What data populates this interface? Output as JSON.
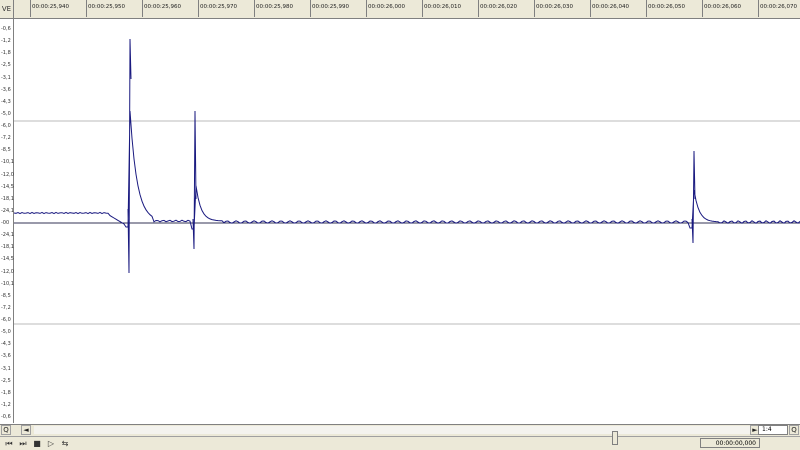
{
  "ruler": {
    "corner_icon": "VE",
    "ticks": [
      "00:00:25,940",
      "00:00:25,950",
      "00:00:25,960",
      "00:00:25,970",
      "00:00:25,980",
      "00:00:25,990",
      "00:00:26,000",
      "00:00:26,010",
      "00:00:26,020",
      "00:00:26,030",
      "00:00:26,040",
      "00:00:26,050",
      "00:00:26,060",
      "00:00:26,070"
    ]
  },
  "yaxis": {
    "labels": [
      "-0,6",
      "-1,2",
      "-1,8",
      "-2,5",
      "-3,1",
      "-3,6",
      "-4,3",
      "-5,0",
      "-6,0",
      "-7,2",
      "-8,5",
      "-10,1",
      "-12,0",
      "-14,5",
      "-18,1",
      "-24,1",
      "-00",
      "-24,1",
      "-18,1",
      "-14,5",
      "-12,0",
      "-10,1",
      "-8,5",
      "-7,2",
      "-6,0",
      "-5,0",
      "-4,3",
      "-3,6",
      "-3,1",
      "-2,5",
      "-1,8",
      "-1,2",
      "-0,6"
    ]
  },
  "waveform": {
    "color": "#1a1a80",
    "center_line_color": "#333355",
    "grid_color": "#bbbbbb"
  },
  "hscroll": {
    "left_button": "Q",
    "left_arrow": "◄",
    "right_arrow": "►",
    "zoom_value": "1:4",
    "right_button": "Q"
  },
  "status": {
    "buttons": [
      "first-icon",
      "last-icon",
      "stop-icon",
      "play-icon",
      "loop-icon"
    ],
    "time": "00:00:00,000"
  }
}
